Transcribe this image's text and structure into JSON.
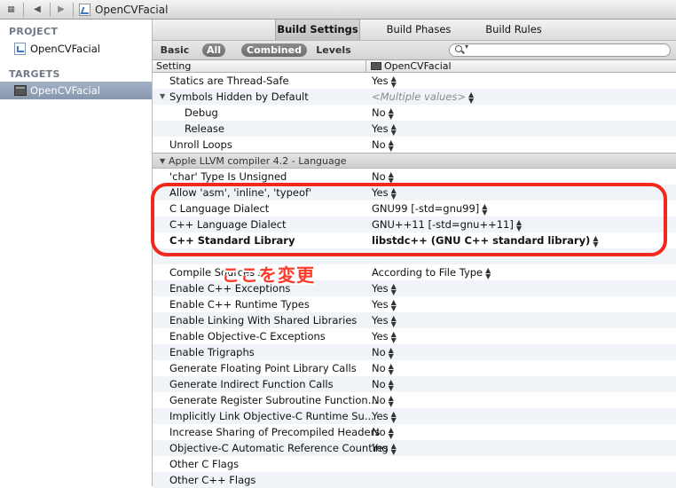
{
  "jumpbar": {
    "title": "OpenCVFacial"
  },
  "sidebar": {
    "project_header": "PROJECT",
    "project_item": "OpenCVFacial",
    "targets_header": "TARGETS",
    "target_item": "OpenCVFacial"
  },
  "tabs": [
    "Build Settings",
    "Build Phases",
    "Build Rules"
  ],
  "filters": {
    "basic": "Basic",
    "all": "All",
    "combined": "Combined",
    "levels": "Levels"
  },
  "columns": {
    "setting": "Setting",
    "target": "OpenCVFacial"
  },
  "rows": [
    {
      "setting": "Statics are Thread-Safe",
      "value": "Yes"
    },
    {
      "setting": "Symbols Hidden by Default",
      "value": "<Multiple values>"
    },
    {
      "setting": "Debug",
      "value": "No"
    },
    {
      "setting": "Release",
      "value": "Yes"
    },
    {
      "setting": "Unroll Loops",
      "value": "No"
    },
    {
      "setting": "'char' Type Is Unsigned",
      "value": "No"
    },
    {
      "setting": "Allow 'asm', 'inline', 'typeof'",
      "value": "Yes"
    },
    {
      "setting": "C Language Dialect",
      "value": "GNU99 [-std=gnu99]"
    },
    {
      "setting": "C++ Language Dialect",
      "value": "GNU++11 [-std=gnu++11]"
    },
    {
      "setting": "C++ Standard Library",
      "value": "libstdc++ (GNU C++ standard library)"
    },
    {
      "setting": "Compile Sources As",
      "value": "According to File Type"
    },
    {
      "setting": "Enable C++ Exceptions",
      "value": "Yes"
    },
    {
      "setting": "Enable C++ Runtime Types",
      "value": "Yes"
    },
    {
      "setting": "Enable Linking With Shared Libraries",
      "value": "Yes"
    },
    {
      "setting": "Enable Objective-C Exceptions",
      "value": "Yes"
    },
    {
      "setting": "Enable Trigraphs",
      "value": "No"
    },
    {
      "setting": "Generate Floating Point Library Calls",
      "value": "No"
    },
    {
      "setting": "Generate Indirect Function Calls",
      "value": "No"
    },
    {
      "setting": "Generate Register Subroutine Function...",
      "value": "No"
    },
    {
      "setting": "Implicitly Link Objective-C Runtime Su...",
      "value": "Yes"
    },
    {
      "setting": "Increase Sharing of Precompiled Headers",
      "value": "No"
    },
    {
      "setting": "Objective-C Automatic Reference Counting",
      "value": "Yes"
    },
    {
      "setting": "Other C Flags",
      "value": ""
    },
    {
      "setting": "Other C++ Flags",
      "value": ""
    }
  ],
  "section": {
    "title": "Apple LLVM compiler 4.2 - Language"
  },
  "annotation": {
    "text": "ここを変更"
  },
  "colors": {
    "annotation_red": "#f2281c",
    "selection": "#8e9cb2"
  }
}
